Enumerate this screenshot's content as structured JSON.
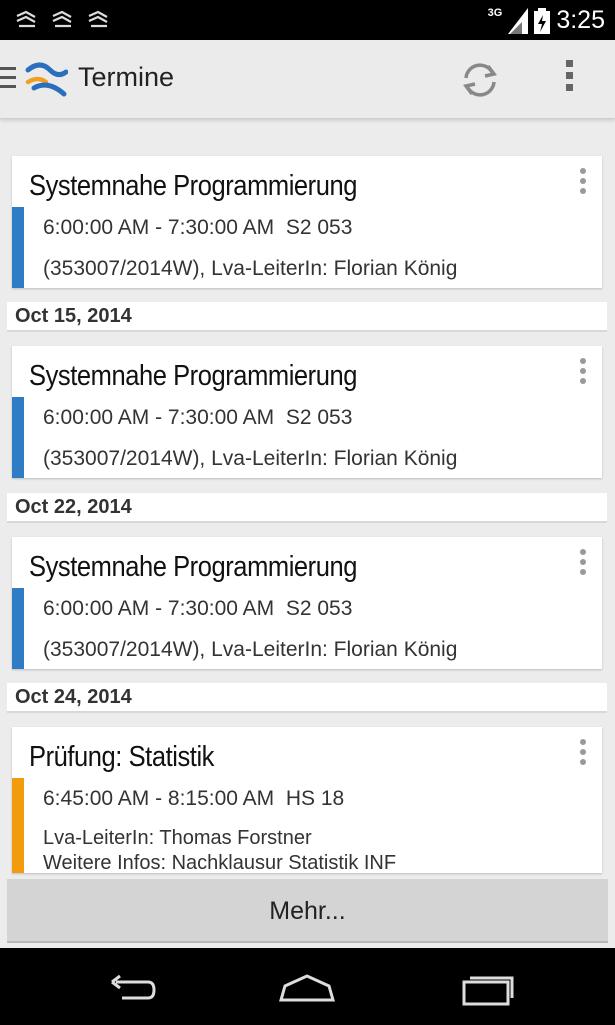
{
  "status_bar": {
    "network": "3G",
    "time": "3:25"
  },
  "action_bar": {
    "title": "Termine"
  },
  "events": [
    {
      "title": "Systemnahe Programmierung",
      "time": "6:00:00 AM - 7:30:00 AM",
      "room": "S2 053",
      "detail": "(353007/2014W), Lva-LeiterIn: Florian König",
      "color": "#2f7bc4"
    },
    {
      "title": "Systemnahe Programmierung",
      "time": "6:00:00 AM - 7:30:00 AM",
      "room": "S2 053",
      "detail": "(353007/2014W), Lva-LeiterIn: Florian König",
      "color": "#2f7bc4"
    },
    {
      "title": "Systemnahe Programmierung",
      "time": "6:00:00 AM - 7:30:00 AM",
      "room": "S2 053",
      "detail": "(353007/2014W), Lva-LeiterIn: Florian König",
      "color": "#2f7bc4"
    },
    {
      "title": "Prüfung: Statistik",
      "time": "6:45:00 AM - 8:15:00 AM",
      "room": "HS 18",
      "detail": "Lva-LeiterIn: Thomas Forstner",
      "detail2": "Weitere Infos: Nachklausur Statistik INF",
      "color": "#f29b0c"
    }
  ],
  "date_headers": [
    "Oct 15, 2014",
    "Oct 22, 2014",
    "Oct 24, 2014"
  ],
  "more_button": "Mehr...",
  "icons": {
    "notification": "wave-notification-icon",
    "refresh": "refresh-icon",
    "overflow": "overflow-menu-icon",
    "back": "back-icon",
    "home": "home-icon",
    "recents": "recents-icon"
  }
}
